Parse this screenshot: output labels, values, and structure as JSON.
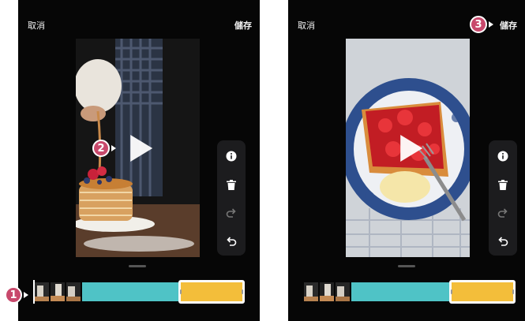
{
  "screens": [
    {
      "header": {
        "cancel_label": "取消",
        "save_label": "儲存"
      },
      "step_badges": [
        "2",
        "1"
      ]
    },
    {
      "header": {
        "cancel_label": "取消",
        "save_label": "儲存"
      },
      "step_badges": [
        "3"
      ]
    }
  ],
  "toolbar_icons": [
    "info-icon",
    "trash-icon",
    "redo-icon",
    "undo-icon"
  ],
  "colors": {
    "badge": "#c8496c",
    "timeline_teal": "#4fc3c6",
    "timeline_yellow": "#f3be3a",
    "background": "#060606"
  }
}
